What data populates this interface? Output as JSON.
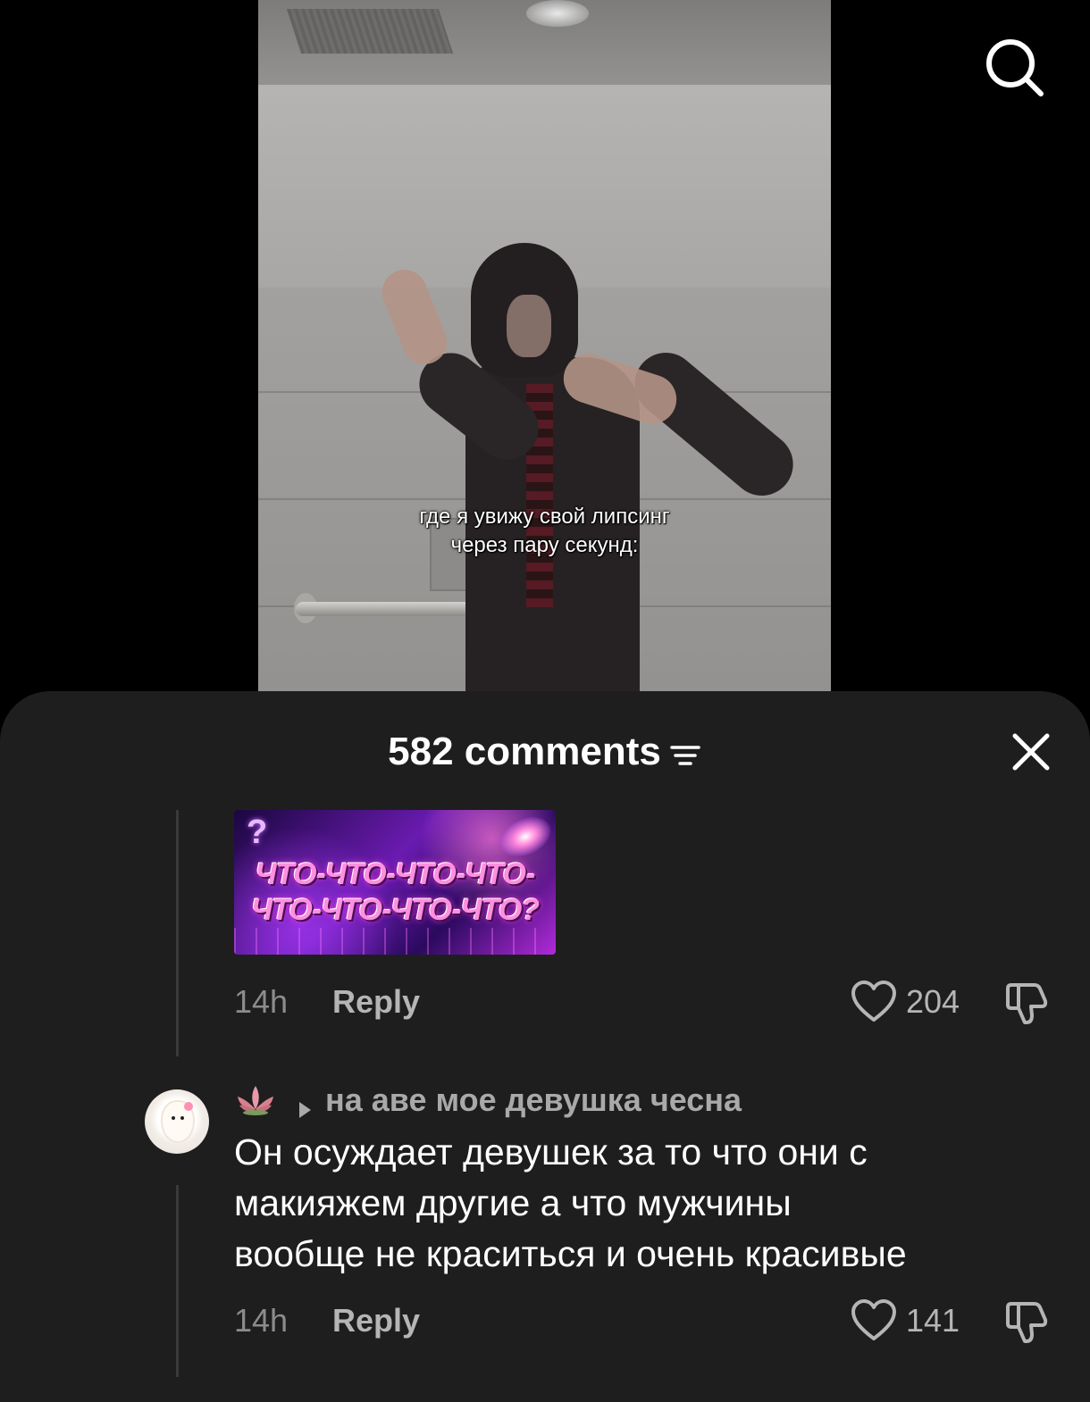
{
  "video": {
    "caption_line1": "где я увижу свой липсинг",
    "caption_line2": "через пару секунд:"
  },
  "header": {
    "search_icon": "search-icon"
  },
  "comments_panel": {
    "title": "582 comments",
    "sort_icon": "sort-filter-icon",
    "close_icon": "close-icon"
  },
  "comments": [
    {
      "sticker_text_line1": "ЧТО-ЧТО-ЧТО-ЧТО-",
      "sticker_text_line2": "ЧТО-ЧТО-ЧТО-ЧТО?",
      "sticker_question_mark": "?",
      "time": "14h",
      "reply_label": "Reply",
      "likes": "204"
    },
    {
      "reply_to": "на аве мое девушка чесна",
      "text": "Он осуждает девушек за то что они с\nмакияжем другие а что мужчины\nвообще не краситься и очень красивые",
      "time": "14h",
      "reply_label": "Reply",
      "likes": "141",
      "icons": [
        "lotus-icon",
        "arrow-right-icon"
      ]
    }
  ],
  "colors": {
    "sheet_background": "#1e1e1e",
    "muted_text": "#8c8c8c",
    "secondary_text": "#b5b5b5"
  }
}
